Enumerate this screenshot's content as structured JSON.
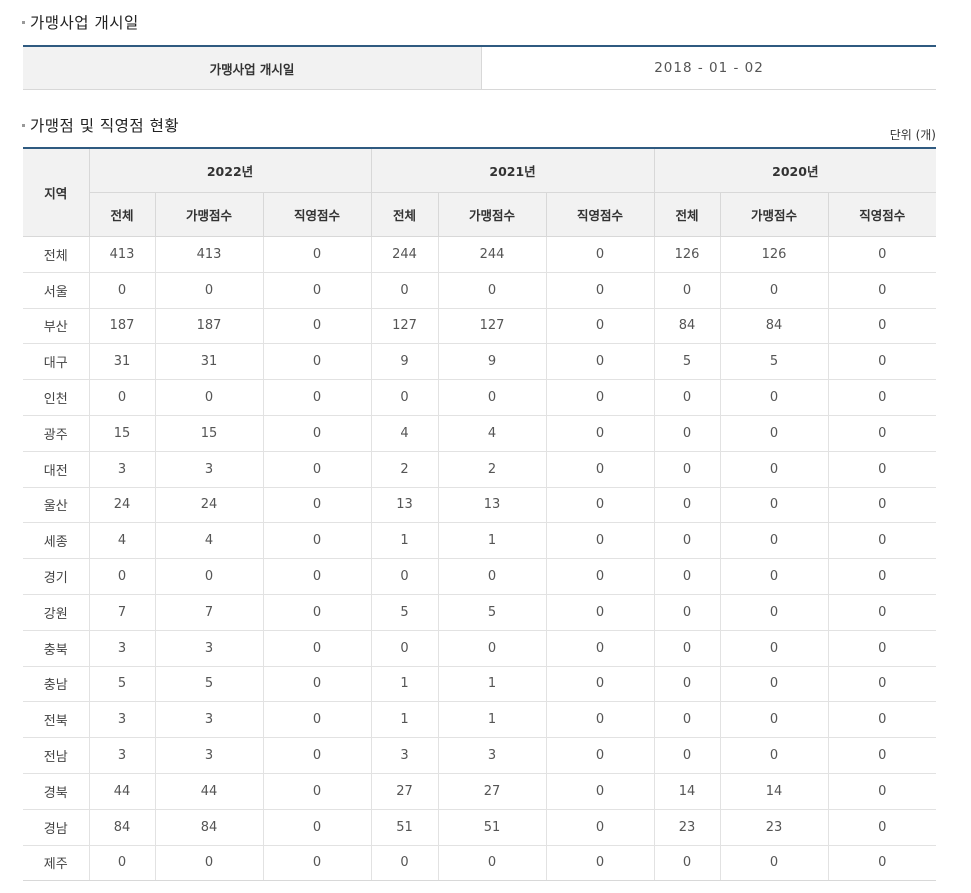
{
  "section1": {
    "title": "가맹사업 개시일",
    "label": "가맹사업 개시일",
    "value": "2018 - 01 - 02"
  },
  "section2": {
    "title": "가맹점 및 직영점 현황",
    "unit": "단위 (개)",
    "region_header": "지역",
    "years": [
      "2022년",
      "2021년",
      "2020년"
    ],
    "subheaders": [
      "전체",
      "가맹점수",
      "직영점수"
    ],
    "rows": [
      {
        "region": "전체",
        "values": [
          "413",
          "413",
          "0",
          "244",
          "244",
          "0",
          "126",
          "126",
          "0"
        ]
      },
      {
        "region": "서울",
        "values": [
          "0",
          "0",
          "0",
          "0",
          "0",
          "0",
          "0",
          "0",
          "0"
        ]
      },
      {
        "region": "부산",
        "values": [
          "187",
          "187",
          "0",
          "127",
          "127",
          "0",
          "84",
          "84",
          "0"
        ]
      },
      {
        "region": "대구",
        "values": [
          "31",
          "31",
          "0",
          "9",
          "9",
          "0",
          "5",
          "5",
          "0"
        ]
      },
      {
        "region": "인천",
        "values": [
          "0",
          "0",
          "0",
          "0",
          "0",
          "0",
          "0",
          "0",
          "0"
        ]
      },
      {
        "region": "광주",
        "values": [
          "15",
          "15",
          "0",
          "4",
          "4",
          "0",
          "0",
          "0",
          "0"
        ]
      },
      {
        "region": "대전",
        "values": [
          "3",
          "3",
          "0",
          "2",
          "2",
          "0",
          "0",
          "0",
          "0"
        ]
      },
      {
        "region": "울산",
        "values": [
          "24",
          "24",
          "0",
          "13",
          "13",
          "0",
          "0",
          "0",
          "0"
        ]
      },
      {
        "region": "세종",
        "values": [
          "4",
          "4",
          "0",
          "1",
          "1",
          "0",
          "0",
          "0",
          "0"
        ]
      },
      {
        "region": "경기",
        "values": [
          "0",
          "0",
          "0",
          "0",
          "0",
          "0",
          "0",
          "0",
          "0"
        ]
      },
      {
        "region": "강원",
        "values": [
          "7",
          "7",
          "0",
          "5",
          "5",
          "0",
          "0",
          "0",
          "0"
        ]
      },
      {
        "region": "충북",
        "values": [
          "3",
          "3",
          "0",
          "0",
          "0",
          "0",
          "0",
          "0",
          "0"
        ]
      },
      {
        "region": "충남",
        "values": [
          "5",
          "5",
          "0",
          "1",
          "1",
          "0",
          "0",
          "0",
          "0"
        ]
      },
      {
        "region": "전북",
        "values": [
          "3",
          "3",
          "0",
          "1",
          "1",
          "0",
          "0",
          "0",
          "0"
        ]
      },
      {
        "region": "전남",
        "values": [
          "3",
          "3",
          "0",
          "3",
          "3",
          "0",
          "0",
          "0",
          "0"
        ]
      },
      {
        "region": "경북",
        "values": [
          "44",
          "44",
          "0",
          "27",
          "27",
          "0",
          "14",
          "14",
          "0"
        ]
      },
      {
        "region": "경남",
        "values": [
          "84",
          "84",
          "0",
          "51",
          "51",
          "0",
          "23",
          "23",
          "0"
        ]
      },
      {
        "region": "제주",
        "values": [
          "0",
          "0",
          "0",
          "0",
          "0",
          "0",
          "0",
          "0",
          "0"
        ]
      }
    ]
  }
}
